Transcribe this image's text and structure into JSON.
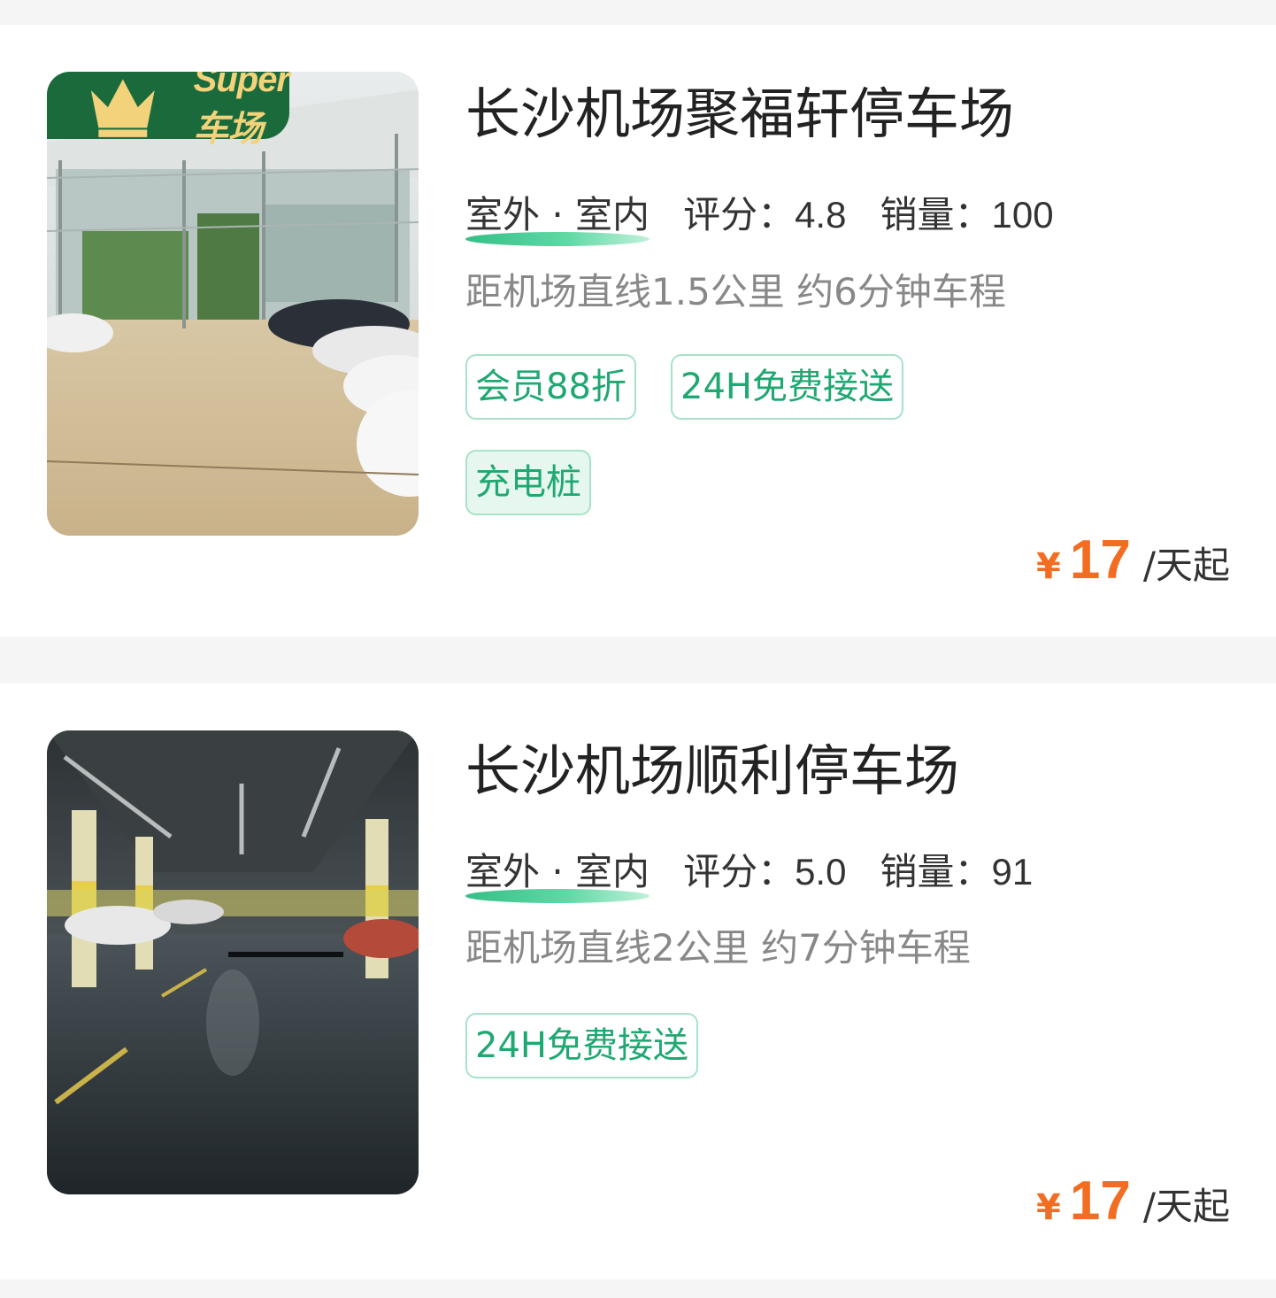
{
  "listings": [
    {
      "name": "长沙机场聚福轩停车场",
      "super_badge": "Super车场",
      "type": "室外 · 室内",
      "rating_label": "评分：",
      "rating": "4.8",
      "sales_label": "销量：",
      "sales": "100",
      "distance": "距机场直线1.5公里 约6分钟车程",
      "tags": [
        "会员88折",
        "24H免费接送",
        "充电桩"
      ],
      "currency": "¥",
      "price": "17",
      "price_unit": "/天起"
    },
    {
      "name": "长沙机场顺利停车场",
      "type": "室外 · 室内",
      "rating_label": "评分：",
      "rating": "5.0",
      "sales_label": "销量：",
      "sales": "91",
      "distance": "距机场直线2公里 约7分钟车程",
      "tags": [
        "24H免费接送"
      ],
      "currency": "¥",
      "price": "17",
      "price_unit": "/天起"
    }
  ],
  "colors": {
    "accent_green": "#1fa871",
    "price_orange": "#f26d21",
    "badge_bg": "#1a6a3c",
    "badge_text": "#f2d27a"
  }
}
